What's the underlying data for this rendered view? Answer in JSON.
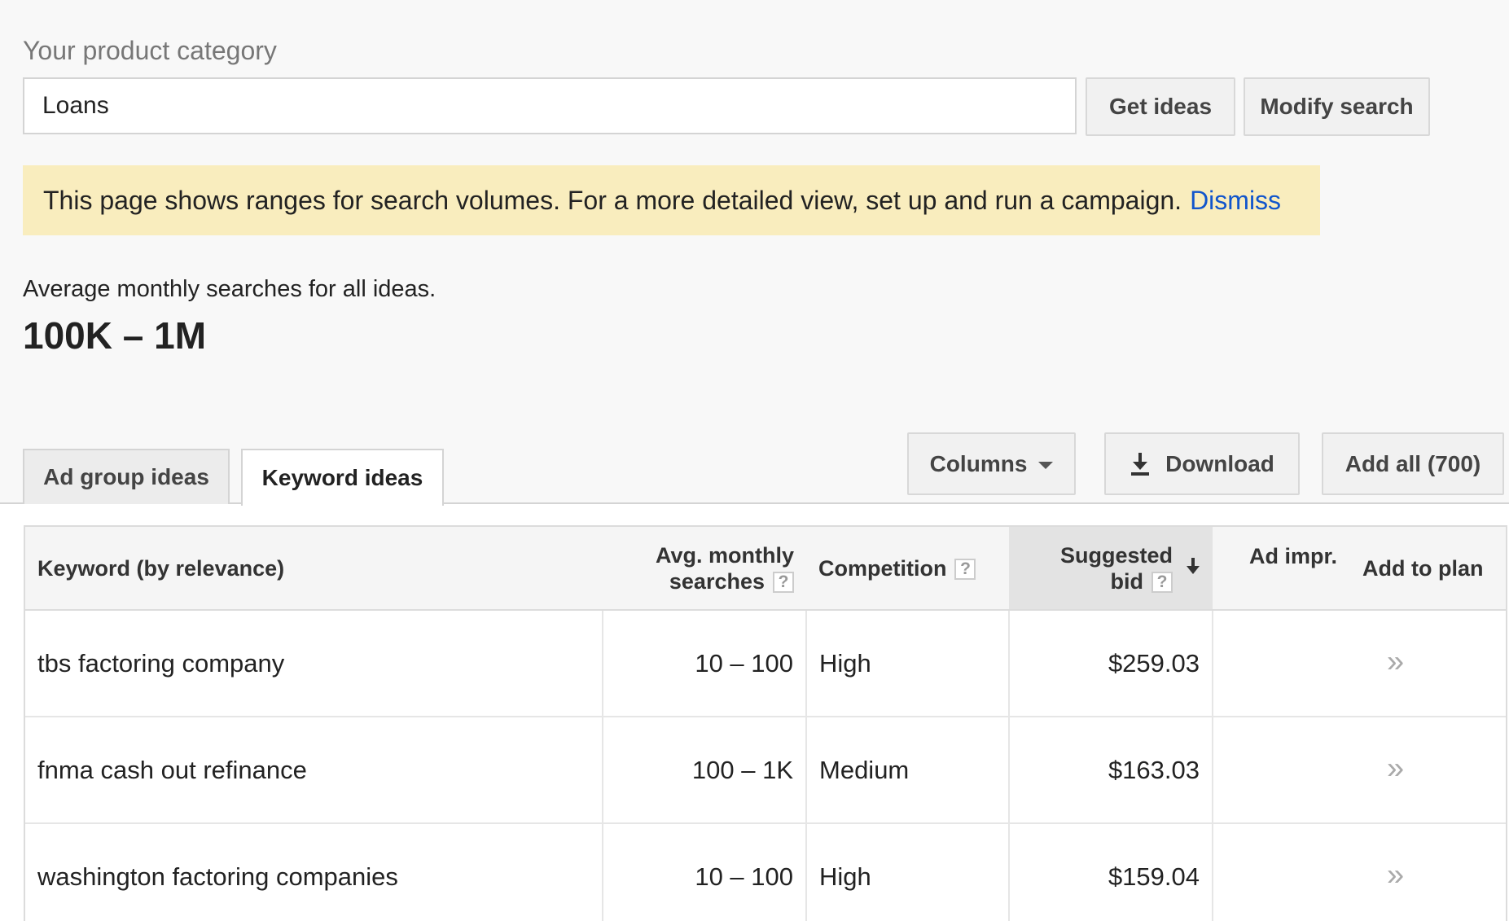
{
  "search": {
    "label": "Your product category",
    "value": "Loans",
    "get_ideas_label": "Get ideas",
    "modify_search_label": "Modify search"
  },
  "notice": {
    "text": "This page shows ranges for search volumes. For a more detailed view, set up and run a campaign.",
    "dismiss_label": "Dismiss"
  },
  "stats": {
    "label": "Average monthly searches for all ideas.",
    "value": "100K – 1M"
  },
  "tabs": [
    {
      "label": "Ad group ideas",
      "active": false
    },
    {
      "label": "Keyword ideas",
      "active": true
    }
  ],
  "toolbar": {
    "columns_label": "Columns",
    "download_label": "Download",
    "add_all_label": "Add all (700)"
  },
  "table": {
    "headers": {
      "keyword": "Keyword (by relevance)",
      "avg_line1": "Avg. monthly",
      "avg_line2": "searches",
      "competition": "Competition",
      "bid_line1": "Suggested",
      "bid_line2": "bid",
      "ad_impr": "Ad impr.",
      "add_to_plan": "Add to plan",
      "help": "?"
    },
    "rows": [
      {
        "keyword": "tbs factoring company",
        "searches": "10 – 100",
        "competition": "High",
        "bid": "$259.03",
        "add": "»"
      },
      {
        "keyword": "fnma cash out refinance",
        "searches": "100 – 1K",
        "competition": "Medium",
        "bid": "$163.03",
        "add": "»"
      },
      {
        "keyword": "washington factoring companies",
        "searches": "10 – 100",
        "competition": "High",
        "bid": "$159.04",
        "add": "»"
      }
    ]
  },
  "colors": {
    "background": "#f8f8f8",
    "notice_bg": "#f9edbe",
    "link": "#1155cc",
    "sorted_header_bg": "#e3e3e3"
  },
  "icons": {
    "columns": "caret-down-icon",
    "download": "download-icon",
    "sort": "arrow-down-icon",
    "add_to_plan": "double-chevron-right-icon",
    "help": "help-icon"
  }
}
